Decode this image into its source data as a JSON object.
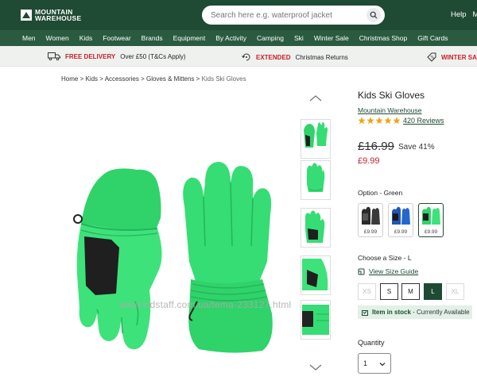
{
  "header": {
    "logo_line1": "MOUNTAIN",
    "logo_line2": "WAREHOUSE",
    "search_placeholder": "Search here e.g. waterproof jacket",
    "links": [
      "Help",
      "My"
    ]
  },
  "nav": {
    "items": [
      "Men",
      "Women",
      "Kids",
      "Footwear",
      "Brands",
      "Equipment",
      "By Activity",
      "Camping",
      "Ski",
      "Winter Sale",
      "Christmas Shop",
      "Gift Cards"
    ]
  },
  "promo": {
    "delivery_red": "FREE DELIVERY",
    "delivery_text": "Over £50 (T&Cs Apply)",
    "returns_red": "EXTENDED",
    "returns_text": "Christmas Returns",
    "sale_red": "WINTER SAL"
  },
  "breadcrumb": {
    "items": [
      "Home",
      "Kids",
      "Accessories",
      "Gloves & Mittens"
    ],
    "separator": " > ",
    "current": "Kids Ski Gloves"
  },
  "watermark": "www.kidstaff.com.ua/tema-233127.html",
  "product": {
    "title": "Kids Ski Gloves",
    "brand": "Mountain Warehouse",
    "rating": 5,
    "reviews": "420 Reviews",
    "old_price": "£16.99",
    "save": "Save 41%",
    "price": "£9.99",
    "option_label": "Option - Green",
    "swatches": [
      {
        "price": "£9.99",
        "color": "#2b2b2b"
      },
      {
        "price": "£9.99",
        "color": "#1f56b8"
      },
      {
        "price": "£9.99",
        "color": "#2fd36a"
      }
    ],
    "size_label": "Choose a Size - L",
    "size_guide": "View Size Guide",
    "sizes": [
      "XS",
      "S",
      "M",
      "L",
      "XL"
    ],
    "stock_bold": "Item in stock",
    "stock_text": " - Currently Available",
    "qty_label": "Quantity",
    "qty_value": "1"
  },
  "colors": {
    "brand_green": "#1f4a34",
    "nav_green": "#2a5a40",
    "sale_red": "#c8202a",
    "glove_green": "#2fd36a",
    "star_gold": "#f2a413"
  }
}
